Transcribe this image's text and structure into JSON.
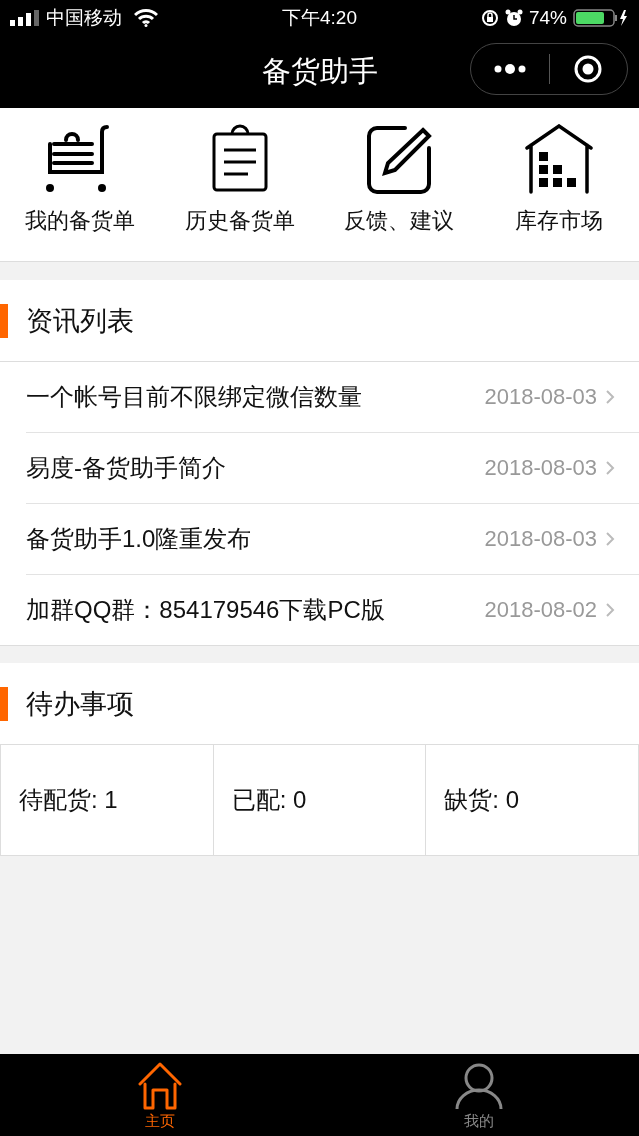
{
  "status_bar": {
    "carrier": "中国移动",
    "time": "下午4:20",
    "battery": "74%"
  },
  "nav_bar": {
    "title": "备货助手"
  },
  "shortcuts": [
    {
      "label": "我的备货单"
    },
    {
      "label": "历史备货单"
    },
    {
      "label": "反馈、建议"
    },
    {
      "label": "库存市场"
    }
  ],
  "news": {
    "title": "资讯列表",
    "items": [
      {
        "title": "一个帐号目前不限绑定微信数量",
        "date": "2018-08-03"
      },
      {
        "title": "易度-备货助手简介",
        "date": "2018-08-03"
      },
      {
        "title": "备货助手1.0隆重发布",
        "date": "2018-08-03"
      },
      {
        "title": "加群QQ群：854179546下载PC版",
        "date": "2018-08-02"
      }
    ]
  },
  "todo": {
    "title": "待办事项",
    "cells": [
      {
        "label": "待配货: 1"
      },
      {
        "label": "已配: 0"
      },
      {
        "label": "缺货: 0"
      }
    ]
  },
  "tab_bar": [
    {
      "label": "主页",
      "selected": true
    },
    {
      "label": "我的",
      "selected": false
    }
  ]
}
